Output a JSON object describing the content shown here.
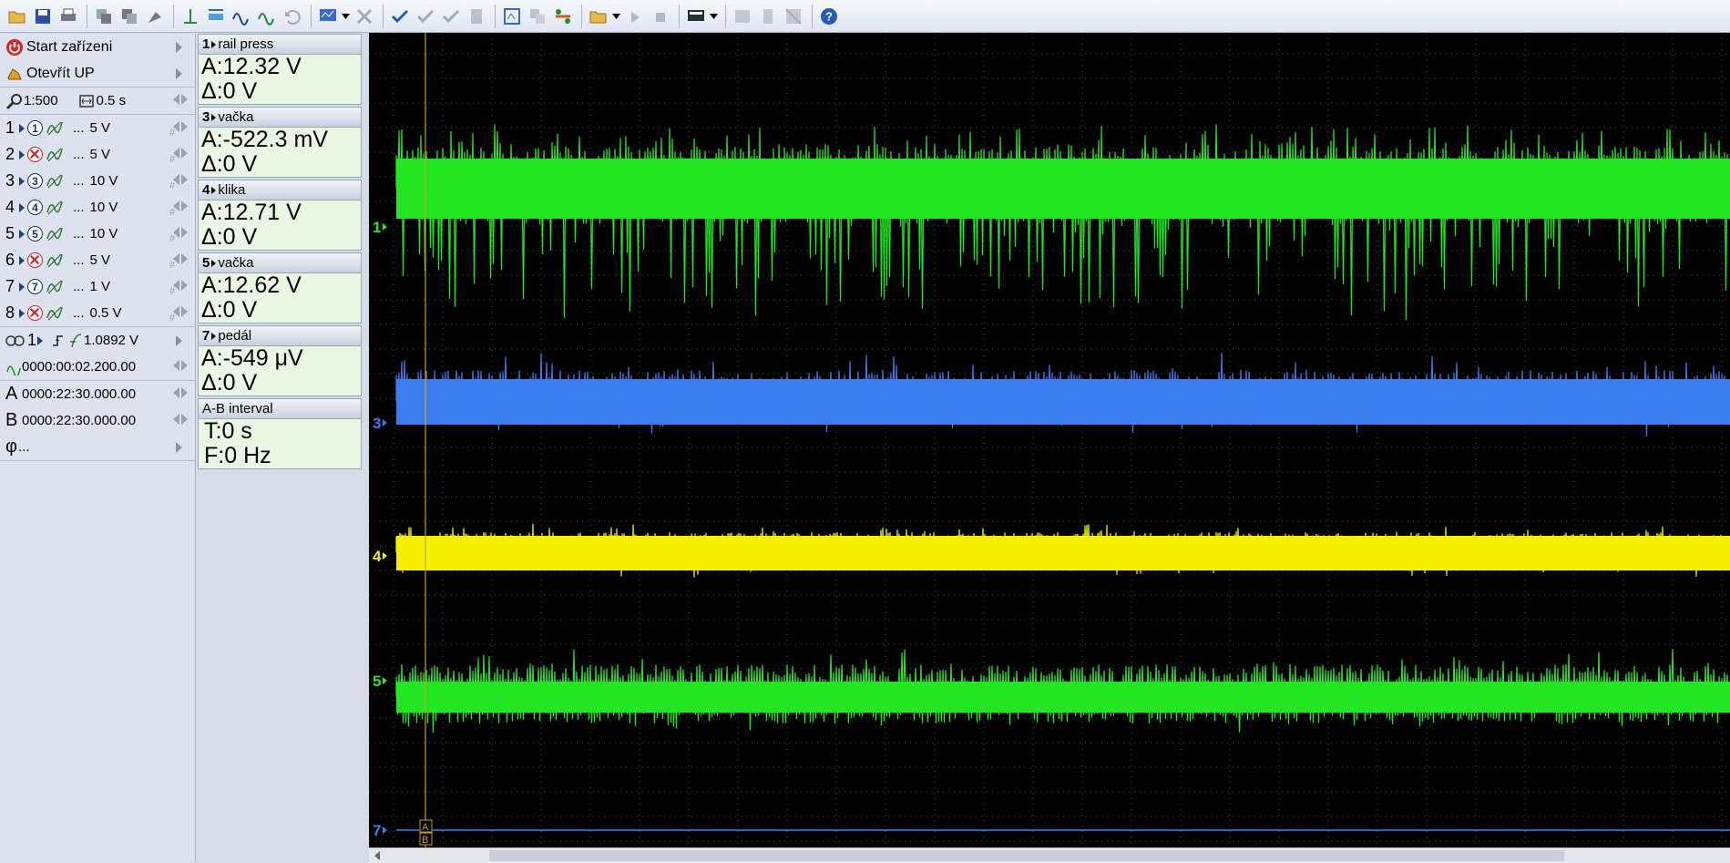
{
  "toolbar": {
    "icons": [
      "open-folder-icon",
      "save-icon",
      "print-icon",
      "copy-icon",
      "paste-icon",
      "tool-icon",
      "cursor-icon",
      "ruler-icon",
      "wave-a-icon",
      "wave-b-icon",
      "undo-icon",
      "screen-icon",
      "close-x-icon",
      "check-icon",
      "check-double-icon",
      "check-triple-icon",
      "doc-icon",
      "zoom-icon",
      "compare-icon",
      "transfer-icon",
      "folder-open-icon",
      "play-icon",
      "stop-icon",
      "display-icon",
      "ghost-a-icon",
      "ghost-b-icon",
      "ghost-c-icon",
      "help-icon"
    ]
  },
  "left_panel": {
    "start_label": "Start zařízeni",
    "open_label": "Otevřít UP",
    "zoom_label": "1:500",
    "time_label": "0.5 s",
    "channels": [
      {
        "num": "1",
        "state": "on",
        "circle": "1",
        "dots": "...",
        "volt": "5 V"
      },
      {
        "num": "2",
        "state": "off",
        "circle": "",
        "dots": "...",
        "volt": "5 V"
      },
      {
        "num": "3",
        "state": "on",
        "circle": "3",
        "dots": "...",
        "volt": "10 V"
      },
      {
        "num": "4",
        "state": "on",
        "circle": "4",
        "dots": "...",
        "volt": "10 V"
      },
      {
        "num": "5",
        "state": "on",
        "circle": "5",
        "dots": "...",
        "volt": "10 V"
      },
      {
        "num": "6",
        "state": "off",
        "circle": "",
        "dots": "...",
        "volt": "5 V"
      },
      {
        "num": "7",
        "state": "on",
        "circle": "7",
        "dots": "...",
        "volt": "1 V"
      },
      {
        "num": "8",
        "state": "off",
        "circle": "",
        "dots": "...",
        "volt": "0.5 V"
      }
    ],
    "trigger_channel": "1",
    "trigger_level": "1.0892 V",
    "trigger_time": "0000:00:02.200.00",
    "cursor_a_label": "A",
    "cursor_a_time": "0000:22:30.000.00",
    "cursor_b_label": "B",
    "cursor_b_time": "0000:22:30.000.00",
    "phi_label": "φ",
    "phi_value": "..."
  },
  "measurements": [
    {
      "num": "1",
      "name": "rail press",
      "a": "A:12.32 V",
      "d": "Δ:0 V"
    },
    {
      "num": "3",
      "name": "vačka",
      "a": "A:-522.3 mV",
      "d": "Δ:0 V"
    },
    {
      "num": "4",
      "name": "klika",
      "a": "A:12.71 V",
      "d": "Δ:0 V"
    },
    {
      "num": "5",
      "name": "vačka",
      "a": "A:12.62 V",
      "d": "Δ:0 V"
    },
    {
      "num": "7",
      "name": "pedál",
      "a": "A:-549 μV",
      "d": "Δ:0 V"
    }
  ],
  "interval": {
    "title": "A-B interval",
    "t": "T:0 s",
    "f": "F:0 Hz"
  },
  "scope": {
    "traces": [
      {
        "label": "1",
        "color": "#22e622"
      },
      {
        "label": "3",
        "color": "#3a7cf0"
      },
      {
        "label": "4",
        "color": "#f5f000"
      },
      {
        "label": "5",
        "color": "#22e622"
      },
      {
        "label": "7",
        "color": "#2a8ee0"
      }
    ],
    "cursor_color": "#c8a020",
    "cursor_a_tag": "A",
    "cursor_b_tag": "B"
  }
}
